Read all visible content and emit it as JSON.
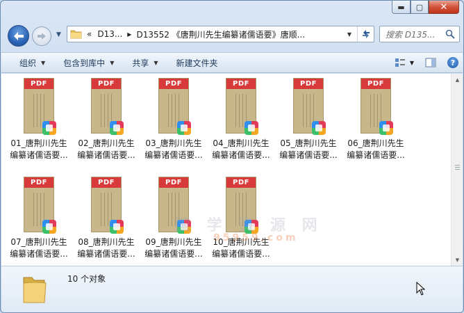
{
  "window": {
    "caption_min": "▬",
    "caption_max": "▢",
    "caption_close": "✕"
  },
  "nav": {
    "back_icon": "back-arrow-icon",
    "forward_icon": "forward-arrow-icon"
  },
  "address": {
    "overflow": "«",
    "crumbs": [
      "D13...",
      "D13552 《唐荆川先生编纂诸儒语要》唐顺..."
    ]
  },
  "search": {
    "placeholder": "搜索 D135..."
  },
  "toolbar": {
    "organize": "组织",
    "include_library": "包含到库中",
    "share": "共享",
    "new_folder": "新建文件夹",
    "help": "?"
  },
  "files": [
    {
      "label": "01_唐荆川先生\n编纂诸儒语要..."
    },
    {
      "label": "02_唐荆川先生\n编纂诸儒语要..."
    },
    {
      "label": "03_唐荆川先生\n编纂诸儒语要..."
    },
    {
      "label": "04_唐荆川先生\n编纂诸儒语要..."
    },
    {
      "label": "05_唐荆川先生\n编纂诸儒语要..."
    },
    {
      "label": "06_唐荆川先生\n编纂诸儒语要..."
    },
    {
      "label": "07_唐荆川先生\n编纂诸儒语要..."
    },
    {
      "label": "08_唐荆川先生\n编纂诸儒语要..."
    },
    {
      "label": "09_唐荆川先生\n编纂诸儒语要..."
    },
    {
      "label": "10_唐荆川先生\n编纂诸儒语要..."
    }
  ],
  "thumb_badge_text": "PDF",
  "watermark": {
    "text": "国 学 资 源 网",
    "url": "95959.com"
  },
  "status": {
    "count": "10 个对象"
  },
  "colors": {
    "pdf_red": "#d8393a",
    "page_tan": "#c8b78a",
    "window_blue": "#c5d8ee"
  }
}
